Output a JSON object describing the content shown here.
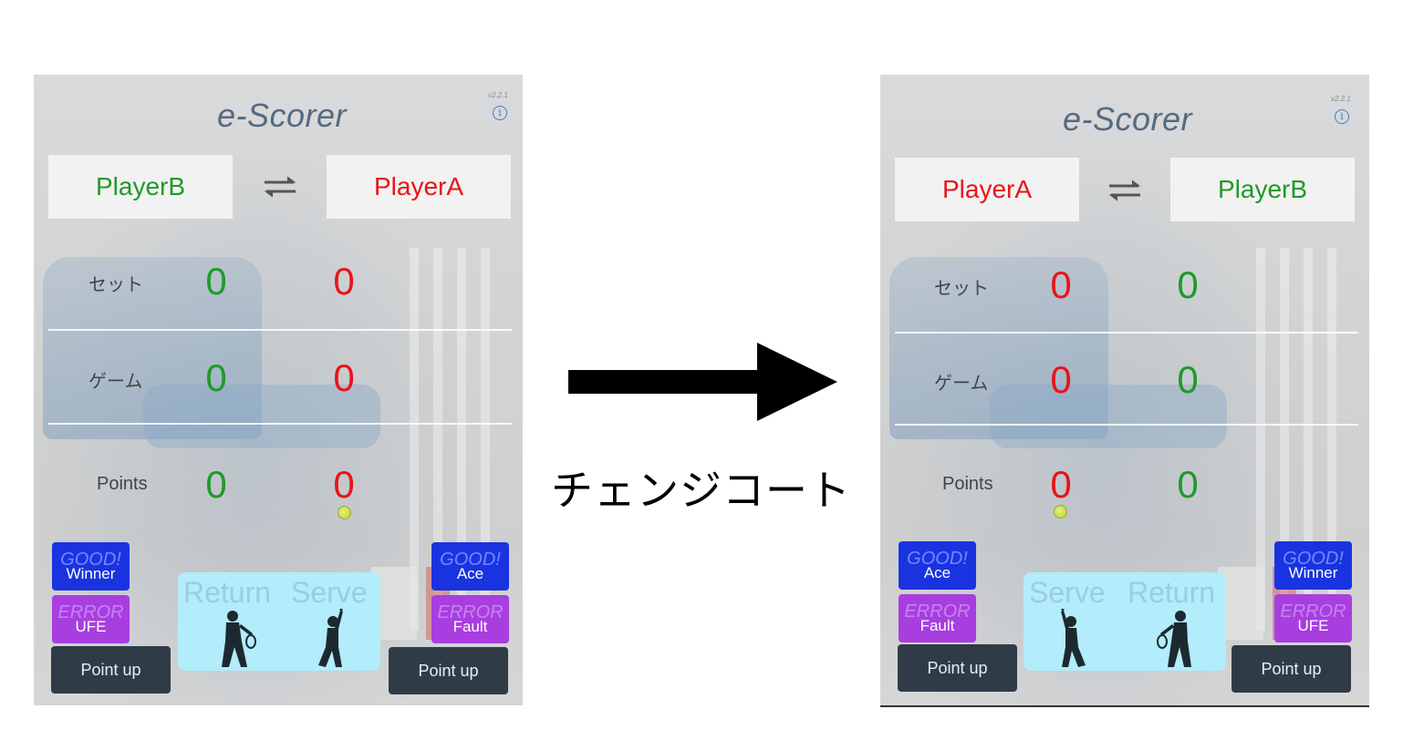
{
  "arrow_caption": "チェンジコート",
  "colors": {
    "player_a": "#e8141a",
    "player_b": "#1f9a2a",
    "good_button": "#1a33e0",
    "error_button": "#a83ee0",
    "point_button": "#2f3c48",
    "court_panel": "#b3ecfa",
    "title": "#556a82",
    "info_icon": "#3b7fd4"
  },
  "before": {
    "version": "v2.2.1",
    "info_icon": "i",
    "title": "e-Scorer",
    "left_player": "PlayerB",
    "right_player": "PlayerA",
    "rows": {
      "set_label": "セット",
      "game_label": "ゲーム",
      "points_label": "Points"
    },
    "scores": {
      "left_set": "0",
      "right_set": "0",
      "left_game": "0",
      "right_game": "0",
      "left_points": "0",
      "right_points": "0"
    },
    "server_side": "right",
    "left_buttons": {
      "good_tag": "GOOD!",
      "good_label": "Winner",
      "error_tag": "ERROR",
      "error_label": "UFE",
      "point_up": "Point up"
    },
    "right_buttons": {
      "good_tag": "GOOD!",
      "good_label": "Ace",
      "error_tag": "ERROR",
      "error_label": "Fault",
      "point_up": "Point up"
    },
    "court": {
      "left_label": "Return",
      "right_label": "Serve"
    }
  },
  "after": {
    "version": "v2.2.1",
    "info_icon": "i",
    "title": "e-Scorer",
    "left_player": "PlayerA",
    "right_player": "PlayerB",
    "rows": {
      "set_label": "セット",
      "game_label": "ゲーム",
      "points_label": "Points"
    },
    "scores": {
      "left_set": "0",
      "right_set": "0",
      "left_game": "0",
      "right_game": "0",
      "left_points": "0",
      "right_points": "0"
    },
    "server_side": "left",
    "left_buttons": {
      "good_tag": "GOOD!",
      "good_label": "Ace",
      "error_tag": "ERROR",
      "error_label": "Fault",
      "point_up": "Point up"
    },
    "right_buttons": {
      "good_tag": "GOOD!",
      "good_label": "Winner",
      "error_tag": "ERROR",
      "error_label": "UFE",
      "point_up": "Point up"
    },
    "court": {
      "left_label": "Serve",
      "right_label": "Return"
    }
  }
}
